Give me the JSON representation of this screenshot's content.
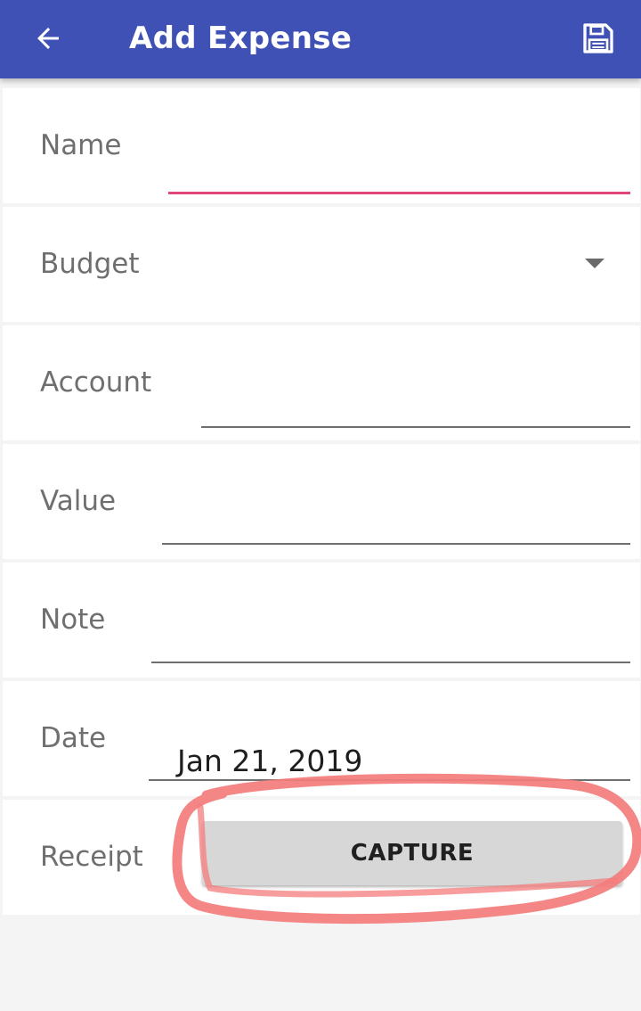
{
  "appbar": {
    "title": "Add Expense",
    "back_icon": "arrow-back-icon",
    "save_icon": "save-floppy-icon",
    "color": "#3f51b5"
  },
  "form": {
    "name": {
      "label": "Name",
      "value": ""
    },
    "budget": {
      "label": "Budget",
      "value": ""
    },
    "account": {
      "label": "Account",
      "value": ""
    },
    "value": {
      "label": "Value",
      "value": ""
    },
    "note": {
      "label": "Note",
      "value": ""
    },
    "date": {
      "label": "Date",
      "value": "Jan 21, 2019"
    },
    "receipt": {
      "label": "Receipt",
      "button_label": "CAPTURE"
    }
  },
  "colors": {
    "focus_underline": "#e2457c",
    "annotation_circle": "#f47c7c"
  }
}
